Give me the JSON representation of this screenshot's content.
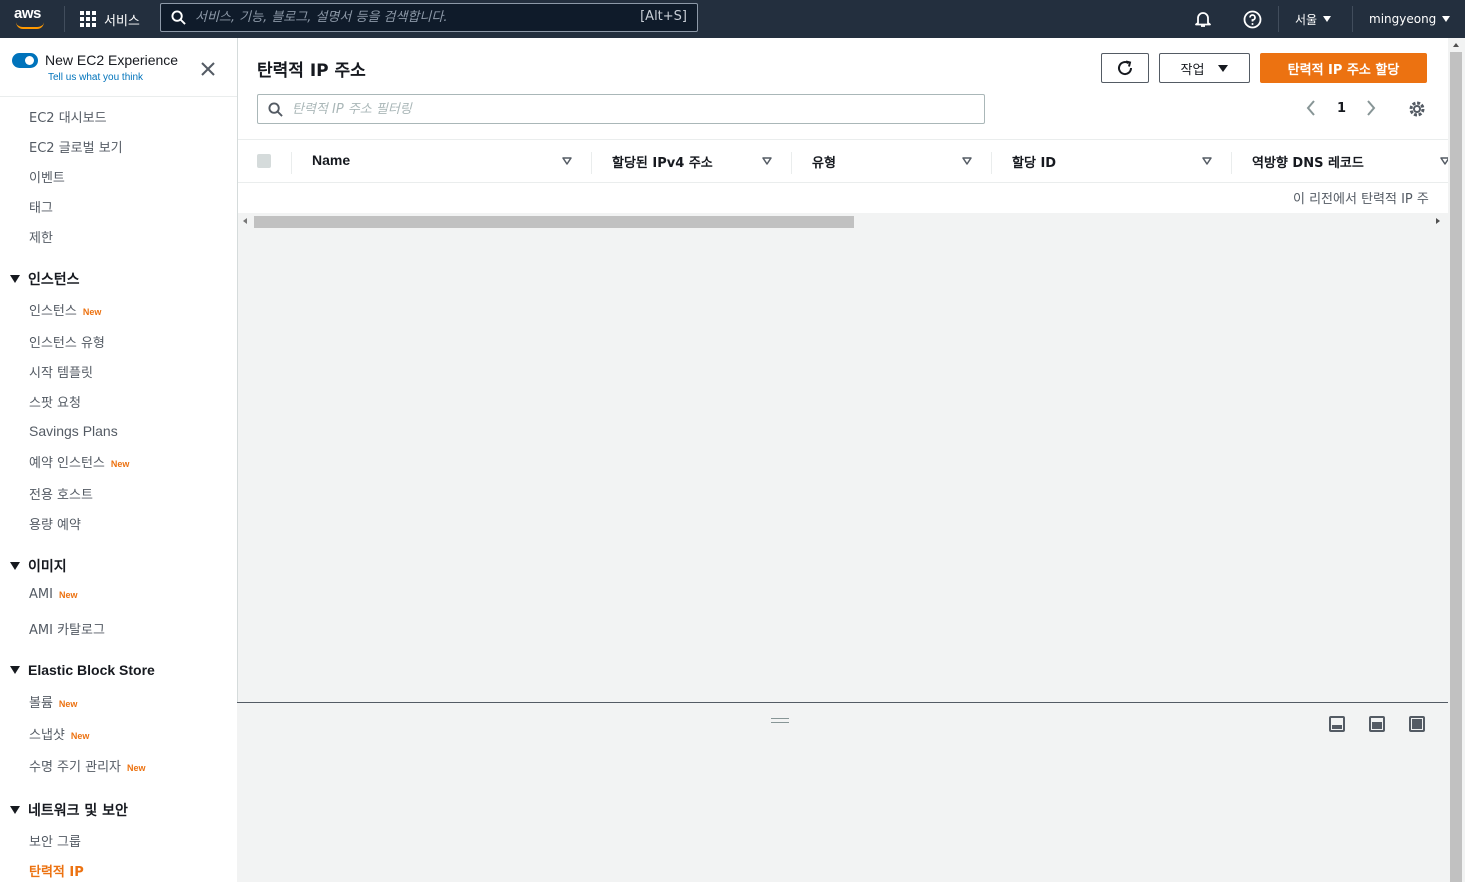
{
  "topnav": {
    "logo_text": "aws",
    "services_label": "서비스",
    "search_placeholder": "서비스, 기능, 블로그, 설명서 등을 검색합니다.",
    "search_shortcut": "[Alt+S]",
    "region_label": "서울",
    "user_label": "mingyeong",
    "icons": [
      "grid-icon",
      "search-icon",
      "bell-icon",
      "help-icon"
    ]
  },
  "sidebar": {
    "experience_title": "New EC2 Experience",
    "experience_sub": "Tell us what you think",
    "new_badge": "New",
    "top_items": [
      {
        "label": "EC2 대시보드"
      },
      {
        "label": "EC2 글로벌 보기"
      },
      {
        "label": "이벤트"
      },
      {
        "label": "태그"
      },
      {
        "label": "제한"
      }
    ],
    "sections": [
      {
        "title": "인스턴스",
        "items": [
          {
            "label": "인스턴스",
            "new": true
          },
          {
            "label": "인스턴스 유형"
          },
          {
            "label": "시작 템플릿"
          },
          {
            "label": "스팟 요청"
          },
          {
            "label": "Savings Plans"
          },
          {
            "label": "예약 인스턴스",
            "new": true
          },
          {
            "label": "전용 호스트"
          },
          {
            "label": "용량 예약"
          }
        ]
      },
      {
        "title": "이미지",
        "items": [
          {
            "label": "AMI",
            "new": true
          },
          {
            "label": "AMI 카탈로그"
          }
        ]
      },
      {
        "title": "Elastic Block Store",
        "items": [
          {
            "label": "볼륨",
            "new": true
          },
          {
            "label": "스냅샷",
            "new": true
          },
          {
            "label": "수명 주기 관리자",
            "new": true
          }
        ]
      },
      {
        "title": "네트워크 및 보안",
        "items": [
          {
            "label": "보안 그룹"
          },
          {
            "label": "탄력적 IP",
            "active": true
          }
        ]
      }
    ]
  },
  "main": {
    "title": "탄력적 IP 주소",
    "actions_label": "작업",
    "allocate_label": "탄력적 IP 주소 할당",
    "filter_placeholder": "탄력적 IP 주소 필터링",
    "page_number": "1",
    "columns": [
      "Name",
      "할당된 IPv4 주소",
      "유형",
      "할당 ID",
      "역방향 DNS 레코드"
    ],
    "empty_message": "이 리전에서 탄력적 IP 주"
  },
  "colors": {
    "nav_bg": "#232f3e",
    "accent_orange": "#ec7211",
    "link_blue": "#0073bb"
  }
}
